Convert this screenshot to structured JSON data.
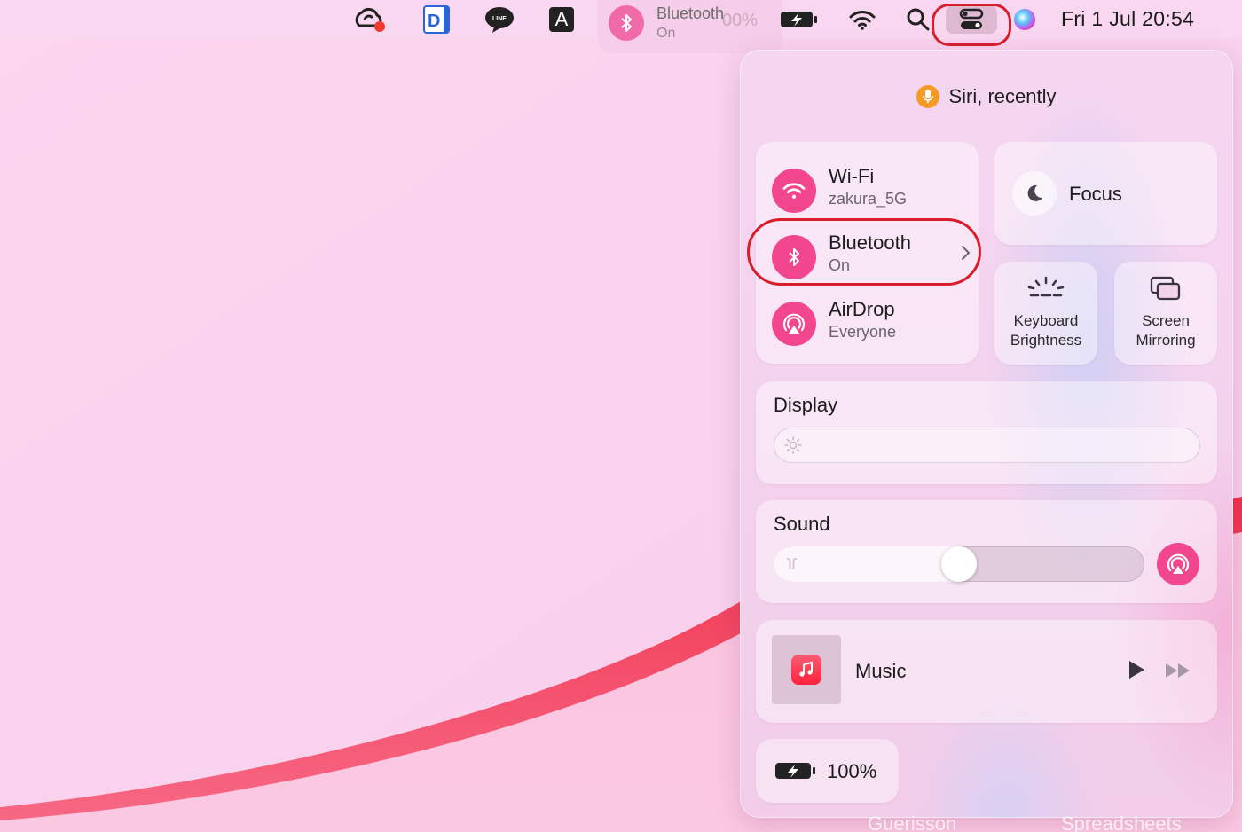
{
  "menubar": {
    "icons": [
      "creative-cloud-icon",
      "dict-app-icon",
      "line-app-icon",
      "input-source-icon",
      "battery-charging-icon",
      "wifi-icon",
      "spotlight-search-icon",
      "control-center-icon",
      "siri-icon"
    ],
    "input_source_letter": "A",
    "line_label": "LINE",
    "clock": "Fri 1 Jul  20:54"
  },
  "bluetooth_toast": {
    "title": "Bluetooth",
    "status": "On",
    "ghost_battery": "00%"
  },
  "control_center": {
    "siri": {
      "label": "Siri, recently"
    },
    "network": {
      "wifi": {
        "title": "Wi-Fi",
        "subtitle": "zakura_5G"
      },
      "bluetooth": {
        "title": "Bluetooth",
        "subtitle": "On"
      },
      "airdrop": {
        "title": "AirDrop",
        "subtitle": "Everyone"
      }
    },
    "focus": {
      "label": "Focus"
    },
    "keyboard_brightness": {
      "line1": "Keyboard",
      "line2": "Brightness"
    },
    "screen_mirroring": {
      "line1": "Screen",
      "line2": "Mirroring"
    },
    "display": {
      "title": "Display",
      "brightness": 0.0
    },
    "sound": {
      "title": "Sound",
      "volume": 0.5
    },
    "music": {
      "label": "Music"
    },
    "battery": {
      "label": "100%"
    }
  },
  "accent_color": "#f2468f",
  "highlight_color": "#d71e2a",
  "bottom_labels": [
    "Guerisson",
    "Spreadsheets"
  ]
}
